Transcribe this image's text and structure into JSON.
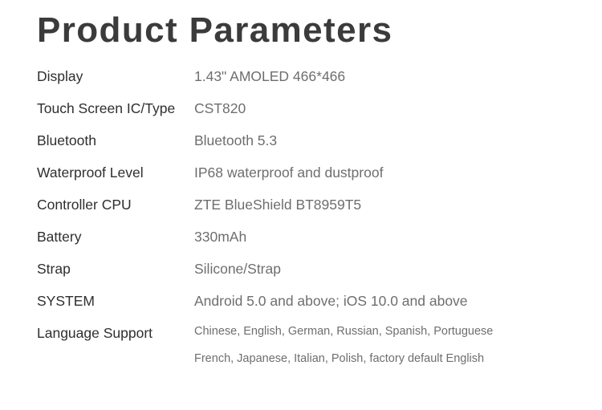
{
  "page": {
    "title": "Product Parameters",
    "background_color": "#ffffff",
    "title_color": "#3b3b3b",
    "label_color": "#2f2f2f",
    "value_color": "#6e6e6e"
  },
  "specs": [
    {
      "label": "Display",
      "value": "1.43\" AMOLED 466*466"
    },
    {
      "label": "Touch Screen IC/Type",
      "value": "CST820"
    },
    {
      "label": "Bluetooth",
      "value": "Bluetooth 5.3"
    },
    {
      "label": "Waterproof Level",
      "value": "IP68 waterproof and dustproof"
    },
    {
      "label": "Controller CPU",
      "value": "ZTE BlueShield BT8959T5"
    },
    {
      "label": "Battery",
      "value": "330mAh"
    },
    {
      "label": "Strap",
      "value": "Silicone/Strap"
    },
    {
      "label": "SYSTEM",
      "value": "Android 5.0 and above; iOS 10.0 and above"
    }
  ],
  "language_support": {
    "label": "Language Support",
    "line1": "Chinese, English, German, Russian, Spanish, Portuguese",
    "line2": "French, Japanese, Italian, Polish, factory default English"
  }
}
